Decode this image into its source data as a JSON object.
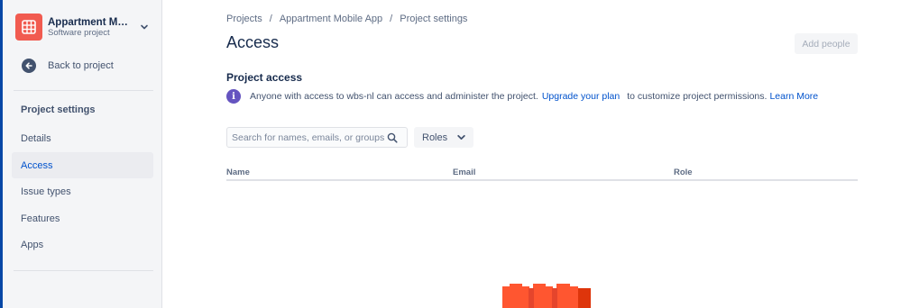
{
  "project": {
    "name": "Appartment Mob...",
    "type": "Software project"
  },
  "sidebar": {
    "back_label": "Back to project",
    "heading": "Project settings",
    "items": [
      {
        "label": "Details"
      },
      {
        "label": "Access"
      },
      {
        "label": "Issue types"
      },
      {
        "label": "Features"
      },
      {
        "label": "Apps"
      }
    ]
  },
  "breadcrumb": [
    "Projects",
    "Appartment Mobile App",
    "Project settings"
  ],
  "page": {
    "title": "Access",
    "add_people_label": "Add people"
  },
  "project_access": {
    "title": "Project access",
    "info_text": "Anyone with access to wbs-nl can access and administer the project.",
    "upgrade_link": "Upgrade your plan",
    "info_text_2": "to customize project permissions.",
    "learn_more": "Learn More"
  },
  "search": {
    "placeholder": "Search for names, emails, or groups",
    "value": ""
  },
  "roles_filter": {
    "label": "Roles"
  },
  "table": {
    "columns": [
      "Name",
      "Email",
      "Role"
    ]
  },
  "colors": {
    "accent": "#0052cc",
    "project_avatar": "#f15b50",
    "info_icon": "#6554c0",
    "illustration": "#ff5630"
  }
}
